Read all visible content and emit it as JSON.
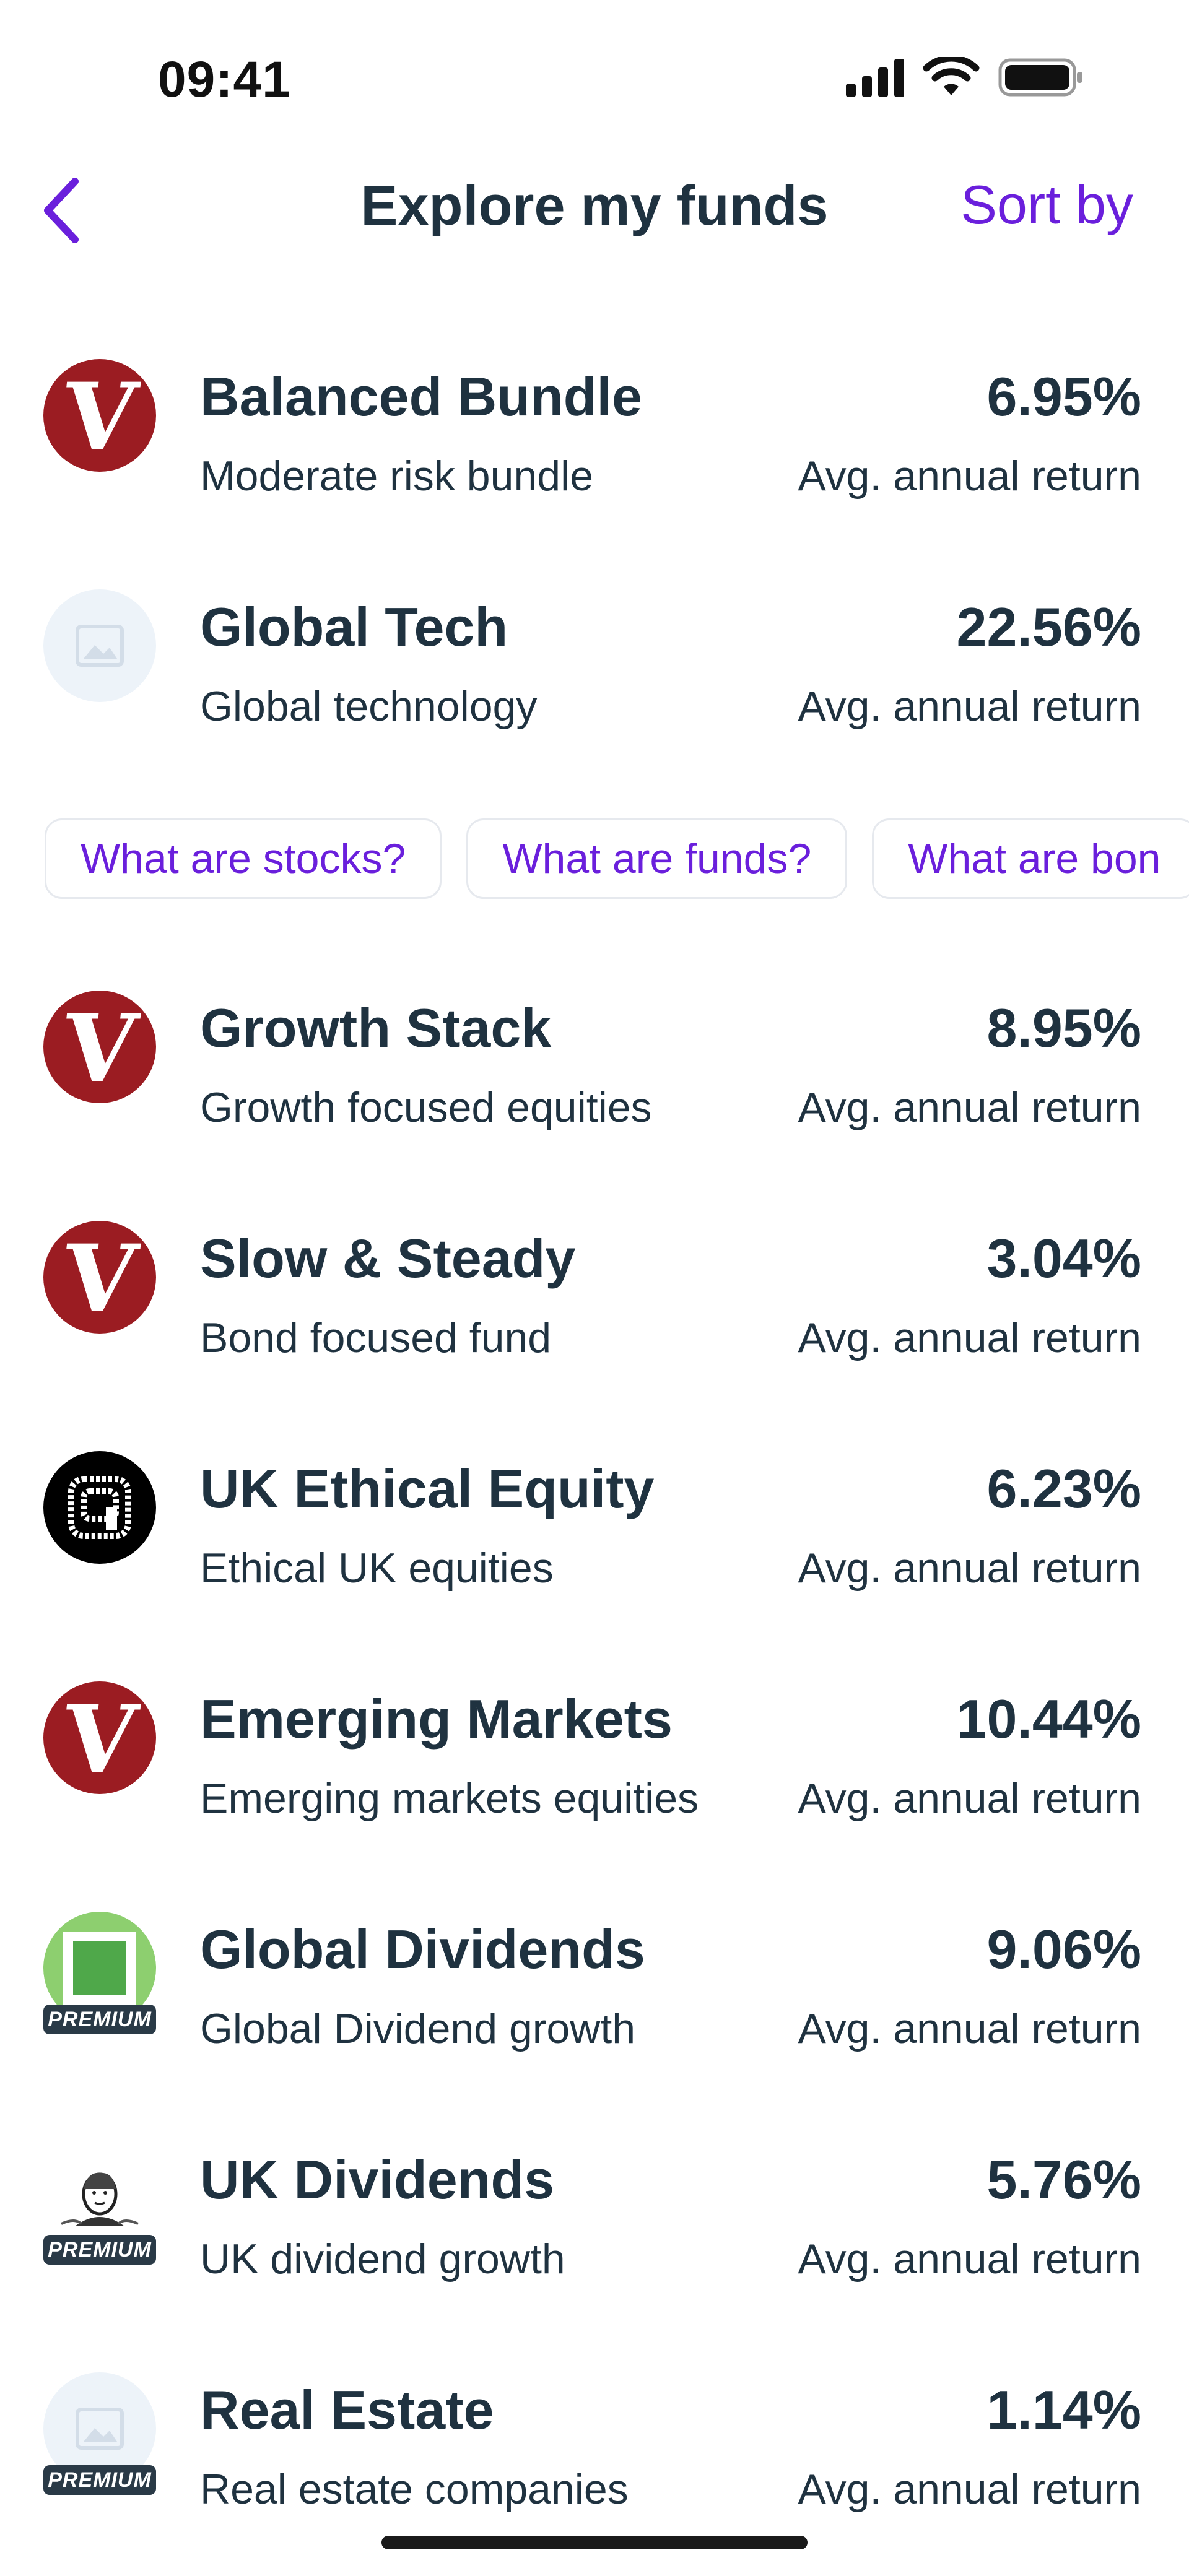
{
  "status_bar": {
    "time": "09:41"
  },
  "nav": {
    "title": "Explore my funds",
    "sort_label": "Sort by"
  },
  "funds_top": [
    {
      "name": "Balanced Bundle",
      "description": "Moderate risk bundle",
      "return": "6.95%",
      "return_label": "Avg. annual return",
      "icon": "vanguard-logo-icon"
    },
    {
      "name": "Global Tech",
      "description": "Global technology",
      "return": "22.56%",
      "return_label": "Avg. annual return",
      "icon": "image-placeholder-icon"
    }
  ],
  "chips": [
    "What are stocks?",
    "What are funds?",
    "What are bon"
  ],
  "funds": [
    {
      "name": "Growth Stack",
      "description": "Growth focused equities",
      "return": "8.95%",
      "return_label": "Avg. annual return",
      "icon": "vanguard-logo-icon"
    },
    {
      "name": "Slow & Steady",
      "description": "Bond focused fund",
      "return": "3.04%",
      "return_label": "Avg. annual return",
      "icon": "vanguard-logo-icon"
    },
    {
      "name": "UK Ethical Equity",
      "description": "Ethical UK equities",
      "return": "6.23%",
      "return_label": "Avg. annual return",
      "icon": "ethical-logo-icon"
    },
    {
      "name": "Emerging Markets",
      "description": "Emerging markets equities",
      "return": "10.44%",
      "return_label": "Avg. annual return",
      "icon": "vanguard-logo-icon"
    },
    {
      "name": "Global Dividends",
      "description": "Global Dividend growth",
      "return": "9.06%",
      "return_label": "Avg. annual return",
      "icon": "green-square-logo-icon",
      "badge": "PREMIUM"
    },
    {
      "name": "UK Dividends",
      "description": "UK dividend growth",
      "return": "5.76%",
      "return_label": "Avg. annual return",
      "icon": "franklin-logo-icon",
      "badge": "PREMIUM"
    },
    {
      "name": "Real Estate",
      "description": "Real estate companies",
      "return": "1.14%",
      "return_label": "Avg. annual return",
      "icon": "image-placeholder-icon",
      "badge": "PREMIUM"
    }
  ],
  "colors": {
    "accent": "#6a1fdc",
    "text": "#1f3240",
    "vanguard_red": "#9b1c22",
    "badge_bg": "#2a3a47"
  }
}
